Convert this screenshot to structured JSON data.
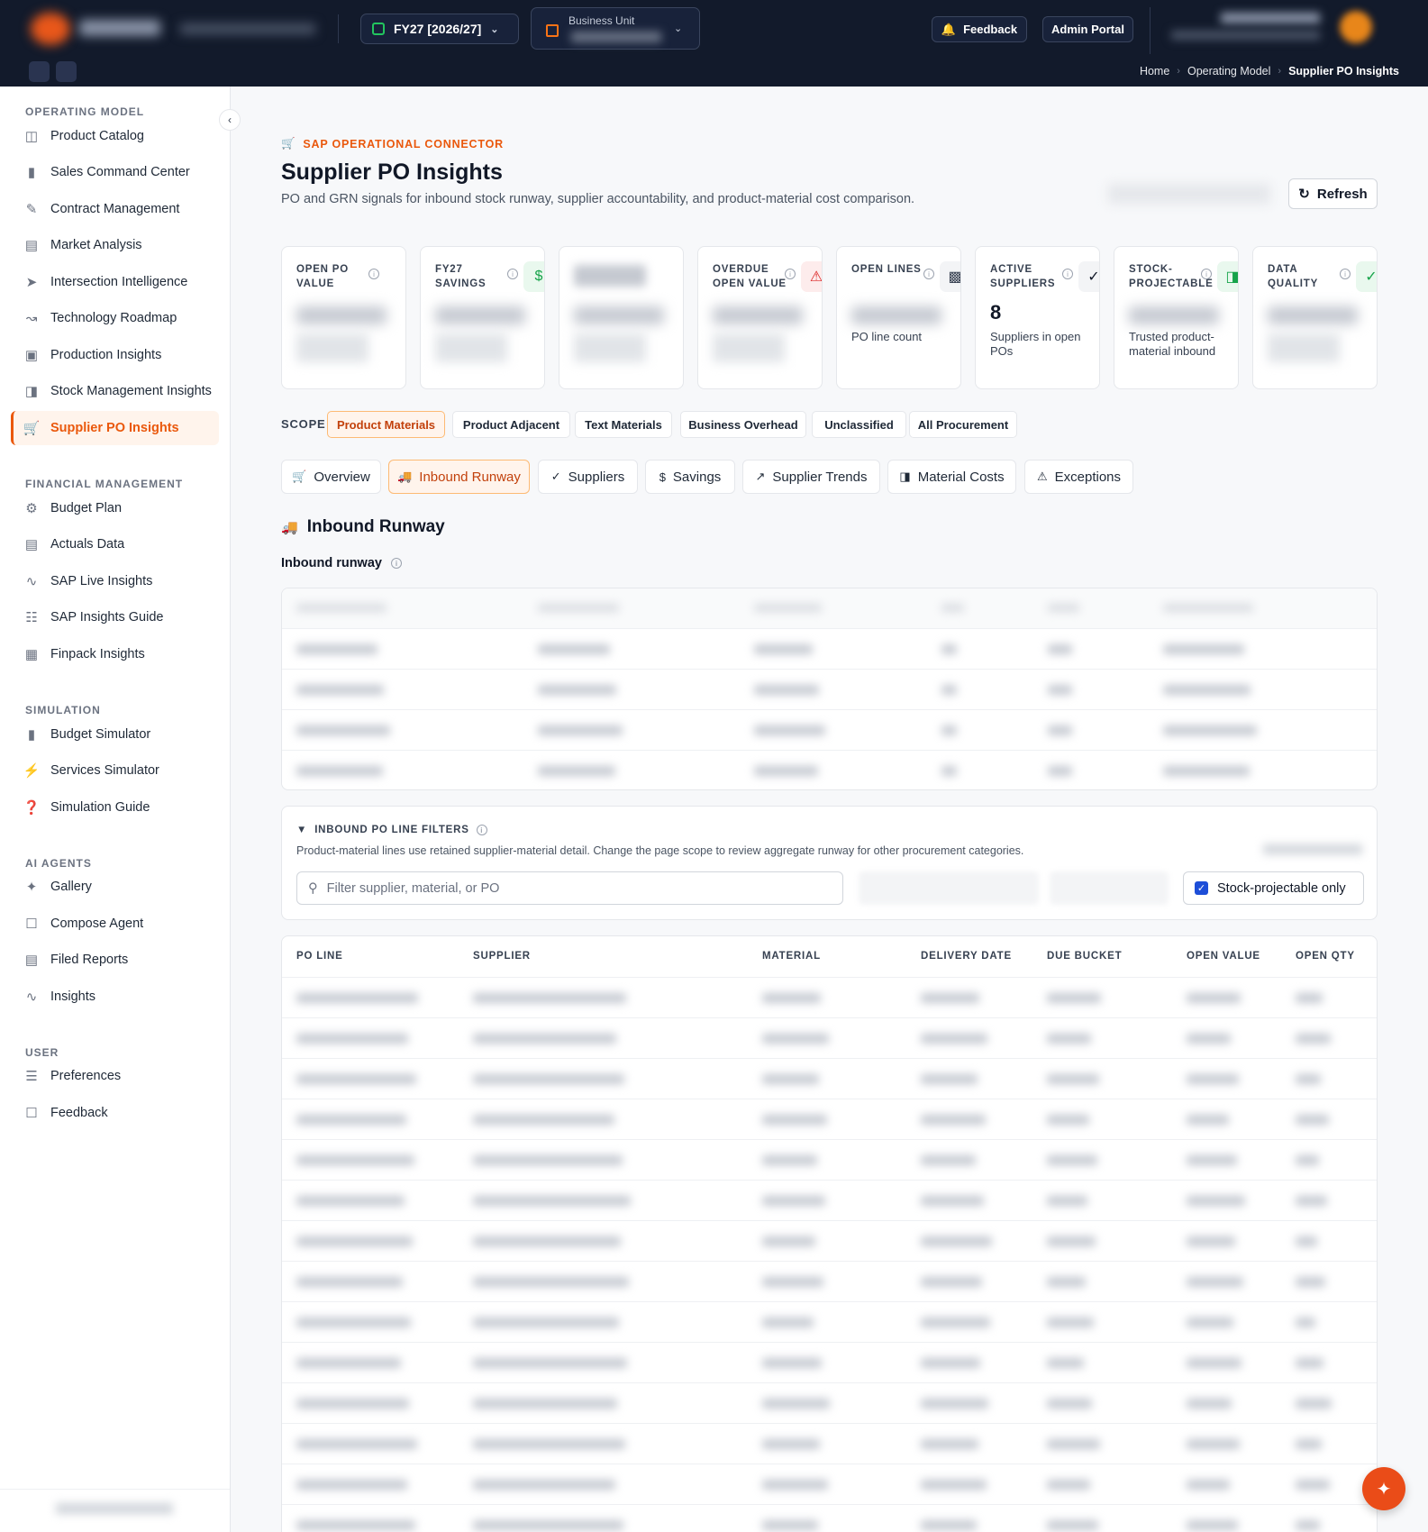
{
  "topbar": {
    "fiscal_year": "FY27 [2026/27]",
    "business_unit_label": "Business Unit",
    "feedback_label": "Feedback",
    "admin_label": "Admin Portal"
  },
  "breadcrumb": [
    "Home",
    "Operating Model",
    "Supplier PO Insights"
  ],
  "sidebar": {
    "sections": [
      {
        "title": "OPERATING MODEL",
        "items": [
          {
            "label": "Product Catalog",
            "icon": "cube-icon"
          },
          {
            "label": "Sales Command Center",
            "icon": "bar-chart-icon"
          },
          {
            "label": "Contract Management",
            "icon": "edit-icon"
          },
          {
            "label": "Market Analysis",
            "icon": "map-icon"
          },
          {
            "label": "Intersection Intelligence",
            "icon": "send-icon"
          },
          {
            "label": "Technology Roadmap",
            "icon": "route-icon"
          },
          {
            "label": "Production Insights",
            "icon": "factory-icon"
          },
          {
            "label": "Stock Management Insights",
            "icon": "boxes-icon"
          },
          {
            "label": "Supplier PO Insights",
            "icon": "cart-icon",
            "active": true
          }
        ]
      },
      {
        "title": "FINANCIAL MANAGEMENT",
        "items": [
          {
            "label": "Budget Plan",
            "icon": "gear-icon"
          },
          {
            "label": "Actuals Data",
            "icon": "document-icon"
          },
          {
            "label": "SAP Live Insights",
            "icon": "pulse-icon"
          },
          {
            "label": "SAP Insights Guide",
            "icon": "book-icon"
          },
          {
            "label": "Finpack Insights",
            "icon": "spreadsheet-icon"
          }
        ]
      },
      {
        "title": "SIMULATION",
        "items": [
          {
            "label": "Budget Simulator",
            "icon": "bar-chart-icon"
          },
          {
            "label": "Services Simulator",
            "icon": "bolt-icon"
          },
          {
            "label": "Simulation Guide",
            "icon": "help-icon"
          }
        ]
      },
      {
        "title": "AI AGENTS",
        "items": [
          {
            "label": "Gallery",
            "icon": "sparkle-icon"
          },
          {
            "label": "Compose Agent",
            "icon": "chat-icon"
          },
          {
            "label": "Filed Reports",
            "icon": "document-icon"
          },
          {
            "label": "Insights",
            "icon": "pulse-icon"
          }
        ]
      },
      {
        "title": "USER",
        "items": [
          {
            "label": "Preferences",
            "icon": "sliders-icon"
          },
          {
            "label": "Feedback",
            "icon": "chat-icon"
          }
        ]
      }
    ]
  },
  "page": {
    "kicker": "SAP OPERATIONAL CONNECTOR",
    "title": "Supplier PO Insights",
    "subtitle": "PO and GRN signals for inbound stock runway, supplier accountability, and product-material cost comparison.",
    "refresh_label": "Refresh"
  },
  "kpis": [
    {
      "label": "OPEN PO VALUE",
      "value": "",
      "sub": "",
      "icon": ""
    },
    {
      "label": "FY27 SAVINGS",
      "value": "",
      "sub": "",
      "icon": "dollar-icon",
      "icon_color": "#16a34a"
    },
    {
      "label": "",
      "value": "",
      "sub": "",
      "icon": ""
    },
    {
      "label": "OVERDUE OPEN VALUE",
      "value": "",
      "sub": "",
      "icon": "alert-icon",
      "icon_color": "#dc2626"
    },
    {
      "label": "OPEN LINES",
      "value": "",
      "sub": "PO line count",
      "icon": "clipboard-icon",
      "icon_color": "#374151"
    },
    {
      "label": "ACTIVE SUPPLIERS",
      "value": "8",
      "sub": "Suppliers in open POs",
      "icon": "check-circle-icon",
      "icon_color": "#111827"
    },
    {
      "label": "STOCK-PROJECTABLE",
      "value": "",
      "sub": "Trusted product-material inbound",
      "icon": "boxes-icon",
      "icon_color": "#16a34a"
    },
    {
      "label": "DATA QUALITY",
      "value": "",
      "sub": "",
      "icon": "check-circle-icon",
      "icon_color": "#16a34a"
    }
  ],
  "scope": {
    "label": "SCOPE",
    "chips": [
      "Product Materials",
      "Product Adjacent",
      "Text Materials",
      "Business Overhead",
      "Unclassified",
      "All Procurement"
    ],
    "selected": "Product Materials"
  },
  "tabs": [
    {
      "label": "Overview",
      "icon": "cart-icon"
    },
    {
      "label": "Inbound Runway",
      "icon": "truck-icon",
      "active": true
    },
    {
      "label": "Suppliers",
      "icon": "check-circle-icon"
    },
    {
      "label": "Savings",
      "icon": "dollar-icon"
    },
    {
      "label": "Supplier Trends",
      "icon": "trend-up-icon"
    },
    {
      "label": "Material Costs",
      "icon": "boxes-icon"
    },
    {
      "label": "Exceptions",
      "icon": "alert-icon"
    }
  ],
  "runway": {
    "section_title": "Inbound Runway",
    "table_title": "Inbound runway",
    "row_count": 4
  },
  "filters": {
    "title": "INBOUND PO LINE FILTERS",
    "description": "Product-material lines use retained supplier-material detail. Change the page scope to review aggregate runway for other procurement categories.",
    "search_placeholder": "Filter supplier, material, or PO",
    "stock_projectable_label": "Stock-projectable only",
    "stock_projectable_checked": true
  },
  "po_table": {
    "columns": [
      "PO LINE",
      "SUPPLIER",
      "MATERIAL",
      "DELIVERY DATE",
      "DUE BUCKET",
      "OPEN VALUE",
      "OPEN QTY"
    ],
    "row_count": 14
  },
  "colors": {
    "accent": "#ea580c",
    "topbar": "#121a2b",
    "checkbox": "#1d4ed8"
  }
}
